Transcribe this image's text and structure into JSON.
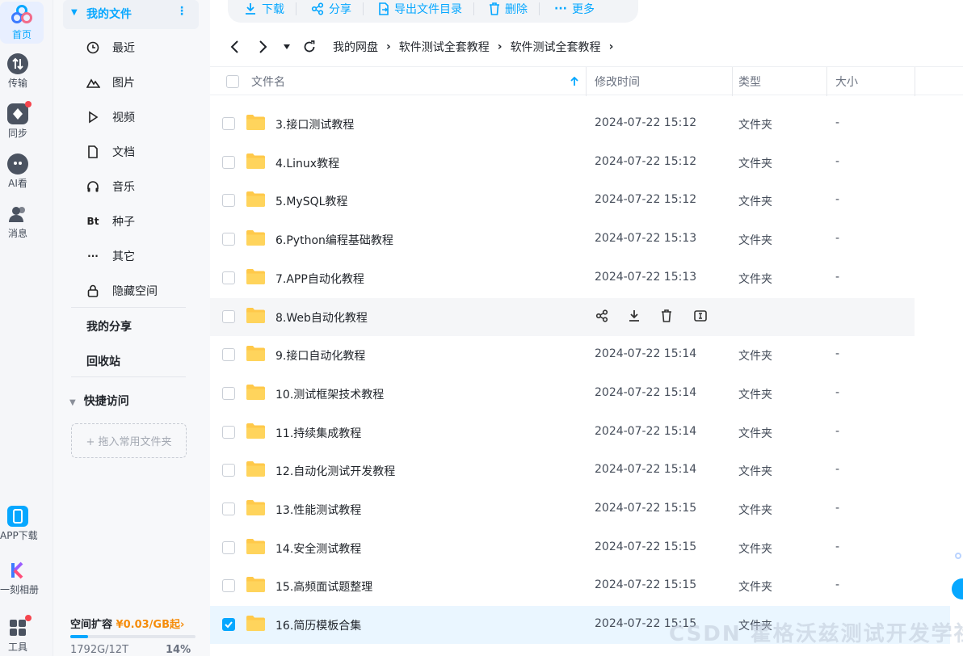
{
  "rail": {
    "home": "首页",
    "transfer": "传输",
    "sync": "同步",
    "ai": "AI看",
    "messages": "消息",
    "app_download": "APP下载",
    "album": "一刻相册",
    "tools": "工具"
  },
  "sidebar": {
    "my_files": "我的文件",
    "items": [
      {
        "label": "最近",
        "icon": "clock-icon"
      },
      {
        "label": "图片",
        "icon": "image-icon"
      },
      {
        "label": "视频",
        "icon": "play-icon"
      },
      {
        "label": "文档",
        "icon": "document-icon"
      },
      {
        "label": "音乐",
        "icon": "headphones-icon"
      },
      {
        "label": "种子",
        "icon": "bt-icon",
        "glyph": "Bt"
      },
      {
        "label": "其它",
        "icon": "more-icon",
        "glyph": "···"
      },
      {
        "label": "隐藏空间",
        "icon": "lock-icon"
      }
    ],
    "my_share": "我的分享",
    "recycle_bin": "回收站",
    "quick_access": "快捷访问",
    "drop_hint": "+ 拖入常用文件夹",
    "storage": {
      "title": "空间扩容",
      "price": "¥0.03/GB起",
      "arrow": "›",
      "used": "1792G/12T",
      "percent_label": "14%",
      "percent": 14
    }
  },
  "toolbar": {
    "download": "下载",
    "share": "分享",
    "export": "导出文件目录",
    "delete": "删除",
    "more": "更多"
  },
  "breadcrumb": [
    "我的网盘",
    "软件测试全套教程",
    "软件测试全套教程"
  ],
  "table": {
    "headers": {
      "name": "文件名",
      "modified": "修改时间",
      "type": "类型",
      "size": "大小"
    },
    "rows": [
      {
        "name": "3.接口测试教程",
        "time": "2024-07-22 15:12",
        "type": "文件夹",
        "size": "-"
      },
      {
        "name": "4.Linux教程",
        "time": "2024-07-22 15:12",
        "type": "文件夹",
        "size": "-"
      },
      {
        "name": "5.MySQL教程",
        "time": "2024-07-22 15:12",
        "type": "文件夹",
        "size": "-"
      },
      {
        "name": "6.Python编程基础教程",
        "time": "2024-07-22 15:13",
        "type": "文件夹",
        "size": "-"
      },
      {
        "name": "7.APP自动化教程",
        "time": "2024-07-22 15:13",
        "type": "文件夹",
        "size": "-"
      },
      {
        "name": "8.Web自动化教程",
        "time": "",
        "type": "",
        "size": "",
        "hover": true
      },
      {
        "name": "9.接口自动化教程",
        "time": "2024-07-22 15:14",
        "type": "文件夹",
        "size": "-"
      },
      {
        "name": "10.测试框架技术教程",
        "time": "2024-07-22 15:14",
        "type": "文件夹",
        "size": "-"
      },
      {
        "name": "11.持续集成教程",
        "time": "2024-07-22 15:14",
        "type": "文件夹",
        "size": "-"
      },
      {
        "name": "12.自动化测试开发教程",
        "time": "2024-07-22 15:14",
        "type": "文件夹",
        "size": "-"
      },
      {
        "name": "13.性能测试教程",
        "time": "2024-07-22 15:15",
        "type": "文件夹",
        "size": "-"
      },
      {
        "name": "14.安全测试教程",
        "time": "2024-07-22 15:15",
        "type": "文件夹",
        "size": "-"
      },
      {
        "name": "15.高频面试题整理",
        "time": "2024-07-22 15:15",
        "type": "文件夹",
        "size": "-"
      },
      {
        "name": "16.简历模板合集",
        "time": "2024-07-22 15:15",
        "type": "文件夹",
        "size": "",
        "selected": true
      }
    ]
  },
  "watermark": "CSDN 霍格沃兹测试开发学社",
  "colors": {
    "accent": "#06a7ff",
    "price": "#f58c0a",
    "folder": "#ffc94a",
    "badge": "#f5454e"
  }
}
